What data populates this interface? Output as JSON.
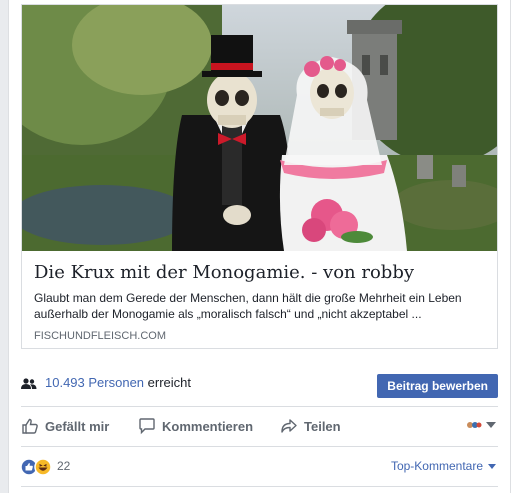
{
  "link_preview": {
    "title": "Die Krux mit der Monogamie. - von robby",
    "description": "Glaubt man dem Gerede der Menschen, dann hält die große Mehrheit ein Leben außerhalb der Monogamie als „moralisch falsch“ und „nicht akzeptabel ...",
    "domain": "FISCHUNDFLEISCH.COM",
    "image_subject": "skeleton bride and groom figurines in front of a church"
  },
  "reach": {
    "count": "10.493 Personen",
    "suffix": " erreicht",
    "promote_label": "Beitrag bewerben"
  },
  "actions": {
    "like_label": "Gefällt mir",
    "comment_label": "Kommentieren",
    "share_label": "Teilen"
  },
  "reactions": {
    "count": "22",
    "types": [
      "like-icon",
      "haha-icon"
    ],
    "sort_label": "Top-Kommentare"
  },
  "colors": {
    "accent": "#4267b2",
    "secondary_text": "#606770",
    "divider": "#dadde1"
  }
}
